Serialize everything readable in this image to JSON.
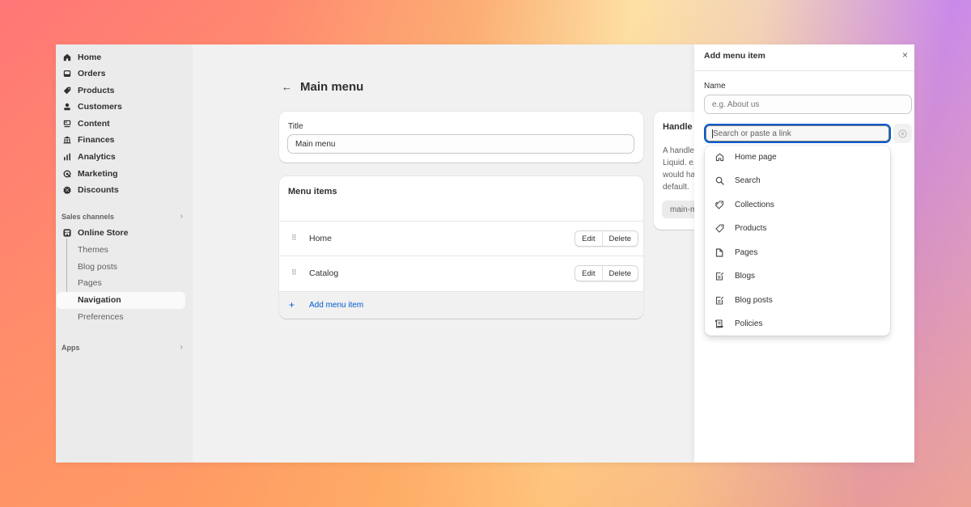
{
  "sidebar": {
    "items": [
      {
        "label": "Home",
        "icon": "home-icon"
      },
      {
        "label": "Orders",
        "icon": "orders-icon"
      },
      {
        "label": "Products",
        "icon": "tag-icon"
      },
      {
        "label": "Customers",
        "icon": "person-icon"
      },
      {
        "label": "Content",
        "icon": "content-icon"
      },
      {
        "label": "Finances",
        "icon": "bank-icon"
      },
      {
        "label": "Analytics",
        "icon": "bar-chart-icon"
      },
      {
        "label": "Marketing",
        "icon": "target-icon"
      },
      {
        "label": "Discounts",
        "icon": "discount-icon"
      }
    ],
    "sales_channels_label": "Sales channels",
    "online_store": {
      "label": "Online Store",
      "sub_items": [
        {
          "label": "Themes",
          "active": false
        },
        {
          "label": "Blog posts",
          "active": false
        },
        {
          "label": "Pages",
          "active": false
        },
        {
          "label": "Navigation",
          "active": true
        },
        {
          "label": "Preferences",
          "active": false
        }
      ]
    },
    "apps_label": "Apps"
  },
  "main": {
    "back_label": "←",
    "title": "Main menu",
    "title_card": {
      "label": "Title",
      "value": "Main menu"
    },
    "menu_items_card": {
      "heading": "Menu items",
      "rows": [
        {
          "label": "Home",
          "edit": "Edit",
          "delete": "Delete"
        },
        {
          "label": "Catalog",
          "edit": "Edit",
          "delete": "Delete"
        }
      ],
      "add_label": "Add menu item"
    },
    "handle_card": {
      "heading": "Handle",
      "description": "A handle is used to reference a menu in Liquid. e.g. a menu with the title \"Main menu\" would have the handle main-menu by default.",
      "value": "main-menu"
    }
  },
  "panel": {
    "title": "Add menu item",
    "close_label": "×",
    "name_label": "Name",
    "name_placeholder": "e.g. About us",
    "name_value": "",
    "link_placeholder": "Search or paste a link",
    "link_value": "",
    "dropdown": [
      {
        "label": "Home page",
        "icon": "home-outline-icon"
      },
      {
        "label": "Search",
        "icon": "search-icon"
      },
      {
        "label": "Collections",
        "icon": "collections-icon"
      },
      {
        "label": "Products",
        "icon": "tag-outline-icon"
      },
      {
        "label": "Pages",
        "icon": "page-icon"
      },
      {
        "label": "Blogs",
        "icon": "blog-icon"
      },
      {
        "label": "Blog posts",
        "icon": "blog-post-icon"
      },
      {
        "label": "Policies",
        "icon": "policy-icon"
      }
    ]
  },
  "colors": {
    "accent": "#005bd3",
    "sidebar_bg": "#ebebeb",
    "main_bg": "#f1f1f1",
    "text": "#303030"
  }
}
